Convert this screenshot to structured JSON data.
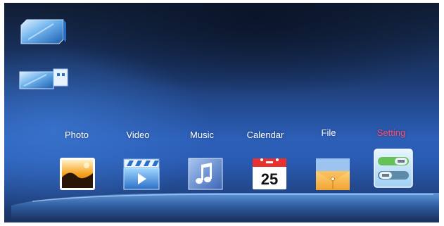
{
  "devices": [
    {
      "name": "sd-card",
      "icon": "sd-card-icon"
    },
    {
      "name": "usb-drive",
      "icon": "usb-drive-icon"
    }
  ],
  "menu": {
    "items": [
      {
        "label": "Photo",
        "icon": "photo-icon"
      },
      {
        "label": "Video",
        "icon": "video-icon"
      },
      {
        "label": "Music",
        "icon": "music-icon"
      },
      {
        "label": "Calendar",
        "icon": "calendar-icon",
        "date": "25"
      },
      {
        "label": "File",
        "icon": "file-icon"
      },
      {
        "label": "Setting",
        "icon": "setting-icon",
        "selected": true
      }
    ]
  },
  "colors": {
    "background_top": "#101d33",
    "background_mid": "#2c5fb8",
    "selected_label": "#ff4b6e",
    "label": "#ffffff"
  }
}
